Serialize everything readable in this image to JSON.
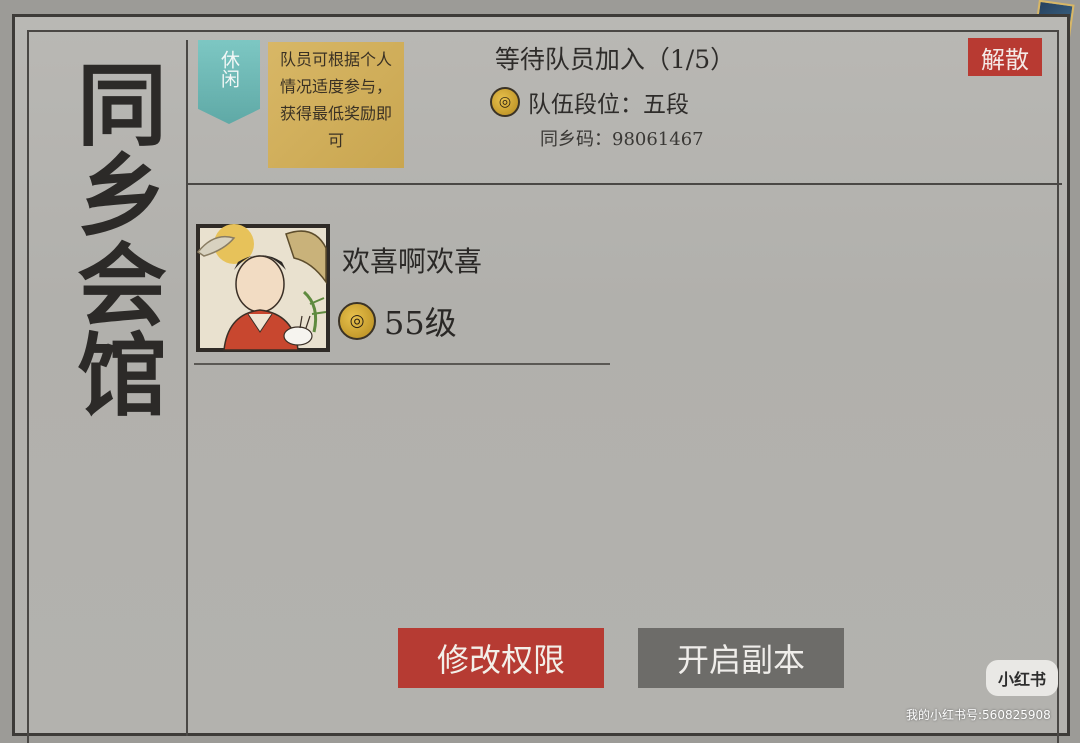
{
  "title": "同乡会馆",
  "mode_tag": "休闲",
  "mode_description": "队员可根据个人情况适度参与，获得最低奖励即可",
  "waiting_text": "等待队员加入（1/5）",
  "team_rank": "队伍段位：五段",
  "hometown_code": "同乡码：98061467",
  "disband_label": "解散",
  "member": {
    "name": "欢喜啊欢喜",
    "level": "55级"
  },
  "buttons": {
    "modify_permissions": "修改权限",
    "start_instance": "开启副本"
  },
  "watermark": {
    "logo": "小红书",
    "id_text": "我的小红书号:560825908"
  },
  "colors": {
    "accent_red": "#b63b33",
    "tag_teal": "#6fb9b5",
    "desc_gold": "#d1ae5b",
    "button_grey": "#6d6c69"
  },
  "icons": [
    "rank-coin-icon",
    "level-coin-icon",
    "corner-badge-icon"
  ]
}
